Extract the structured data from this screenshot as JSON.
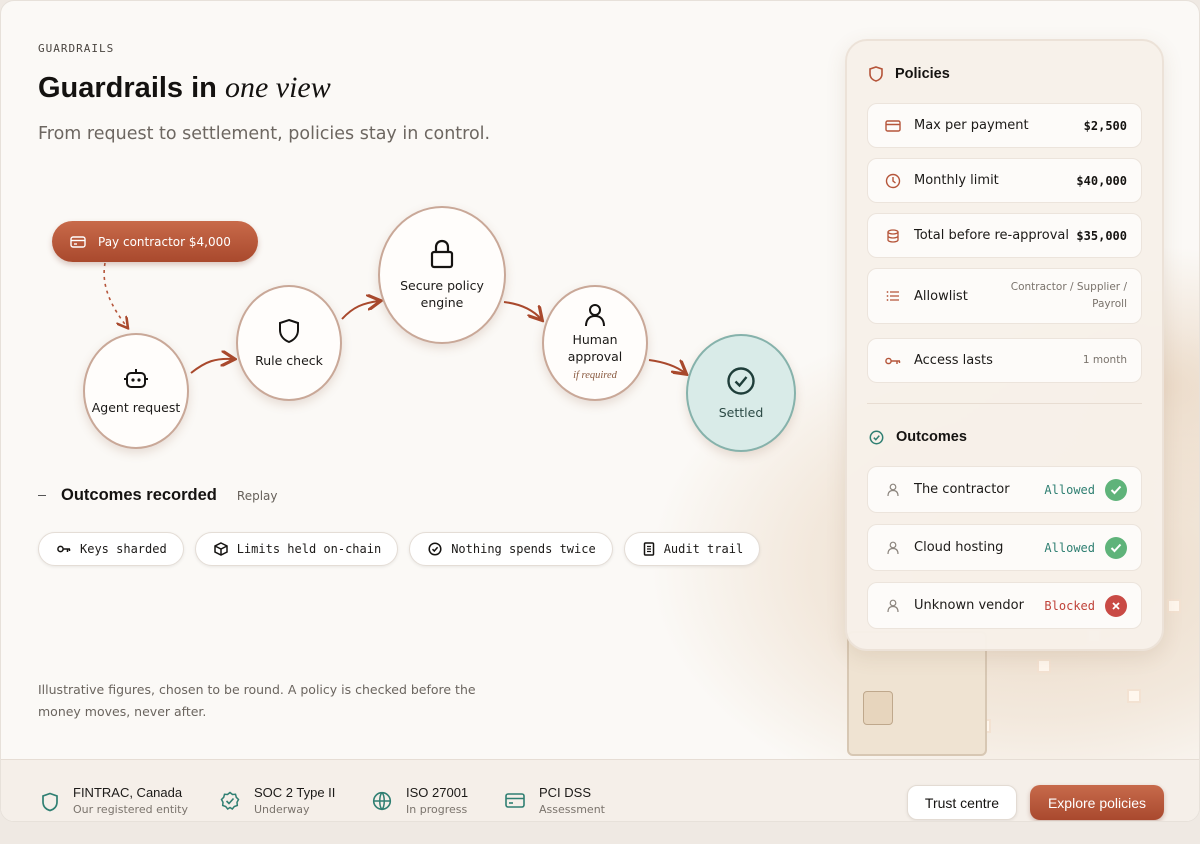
{
  "eyebrow": "GUARDRAILS",
  "title": {
    "main": "Guardrails in",
    "italic": "one view"
  },
  "subtitle": "From request to settlement, policies stay in control.",
  "flow": {
    "request_pill": "Pay contractor $4,000",
    "nodes": [
      {
        "label": "Agent request",
        "icon": "robot-icon"
      },
      {
        "label": "Rule check",
        "icon": "shield-icon"
      },
      {
        "label": "Secure policy engine",
        "icon": "lock-icon"
      },
      {
        "label": "Human approval",
        "note": "if required",
        "icon": "person-icon"
      },
      {
        "label": "Settled",
        "icon": "check-circle-icon"
      }
    ]
  },
  "outcomes_recorded": {
    "label": "Outcomes recorded",
    "replay": "Replay"
  },
  "chips": [
    {
      "label": "Keys sharded",
      "icon": "key-icon"
    },
    {
      "label": "Limits held on-chain",
      "icon": "cube-icon"
    },
    {
      "label": "Nothing spends twice",
      "icon": "check-circle-icon"
    },
    {
      "label": "Audit trail",
      "icon": "document-icon"
    }
  ],
  "disclaimer": "Illustrative figures, chosen to be round. A policy is checked before the money moves, never after.",
  "policies": {
    "title": "Policies",
    "items": [
      {
        "name": "Max per payment",
        "value": "$2,500",
        "icon": "card-icon"
      },
      {
        "name": "Monthly limit",
        "value": "$40,000",
        "icon": "clock-icon"
      },
      {
        "name": "Total before re-approval",
        "value": "$35,000",
        "icon": "database-icon"
      },
      {
        "name": "Allowlist",
        "value": "Contractor / Supplier / Payroll",
        "icon": "list-icon"
      },
      {
        "name": "Access lasts",
        "value": "1 month",
        "icon": "key-icon"
      }
    ]
  },
  "outcomes": {
    "title": "Outcomes",
    "items": [
      {
        "name": "The contractor",
        "status": "Allowed"
      },
      {
        "name": "Cloud hosting",
        "status": "Allowed"
      },
      {
        "name": "Unknown vendor",
        "status": "Blocked"
      }
    ]
  },
  "footer": {
    "certs": [
      {
        "title": "FINTRAC, Canada",
        "sub": "Our registered entity",
        "icon": "shield-icon"
      },
      {
        "title": "SOC 2 Type II",
        "sub": "Underway",
        "icon": "badge-check-icon"
      },
      {
        "title": "ISO 27001",
        "sub": "In progress",
        "icon": "globe-icon"
      },
      {
        "title": "PCI DSS",
        "sub": "Assessment",
        "icon": "card-icon"
      }
    ],
    "trust_button": "Trust centre",
    "explore_button": "Explore policies"
  },
  "colors": {
    "accent": "#b5553a",
    "teal": "#2f7f72",
    "success": "#5fb37a",
    "danger": "#c94a45"
  }
}
